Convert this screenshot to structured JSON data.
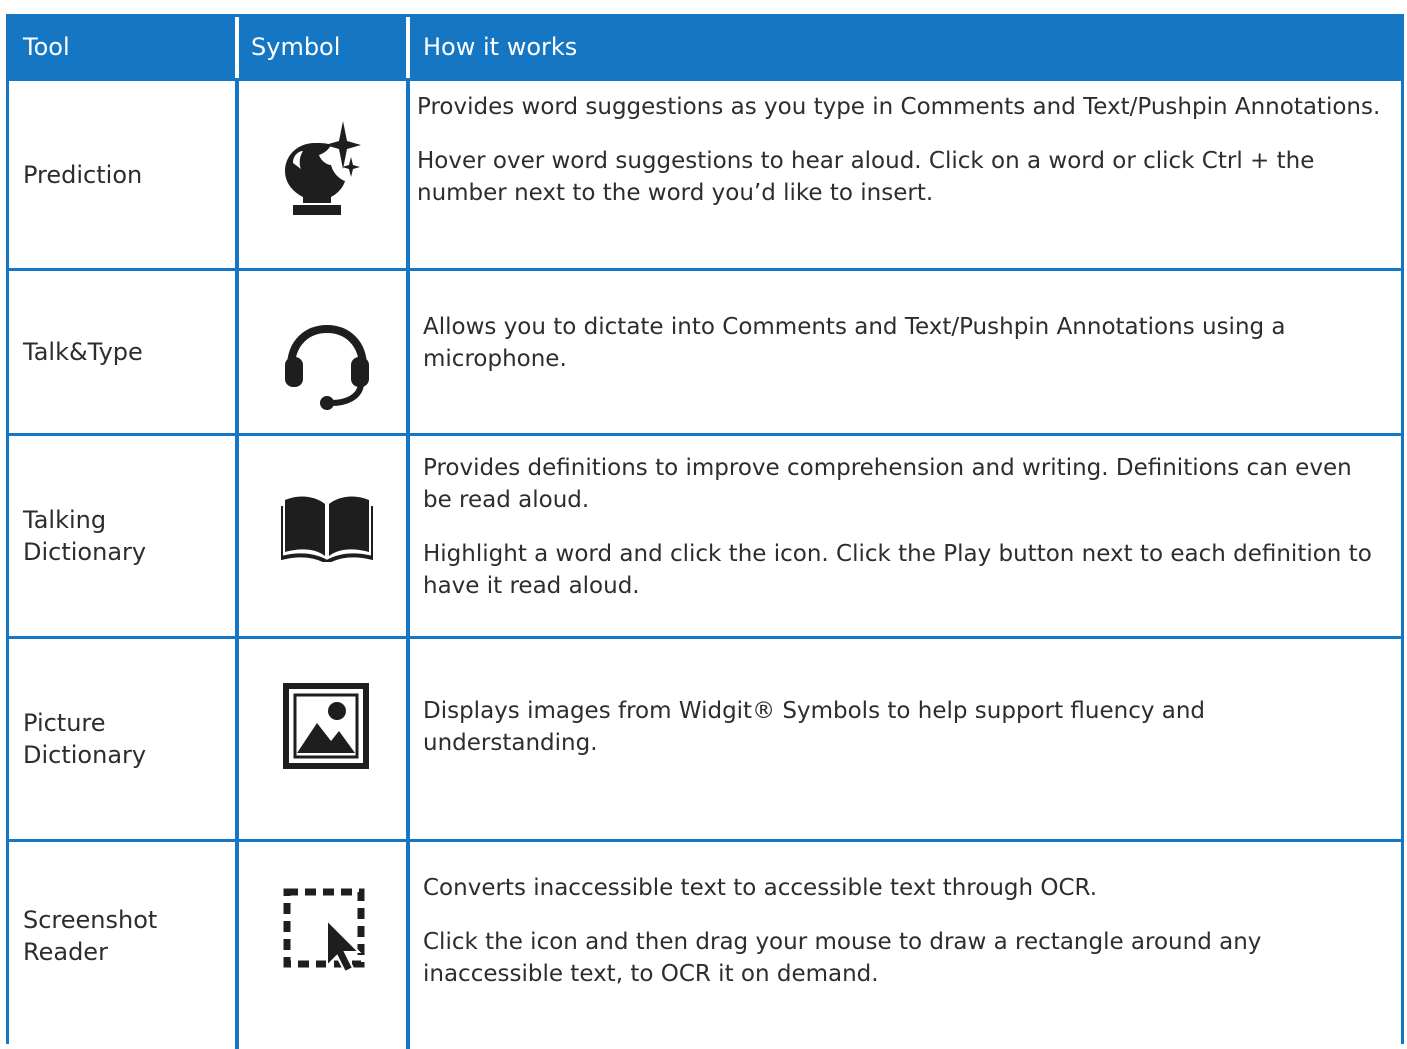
{
  "header": {
    "tool": "Tool",
    "symbol": "Symbol",
    "how": "How it works"
  },
  "rows": [
    {
      "tool_lines": [
        "Prediction"
      ],
      "icon": "prediction-crystal-ball-icon",
      "paragraphs": [
        "Provides word suggestions as you type in Comments and Text/Pushpin Annotations.",
        "Hover over word suggestions to hear aloud. Click on a word or click Ctrl + the number next to the word you’d like to insert."
      ]
    },
    {
      "tool_lines": [
        "Talk&Type"
      ],
      "icon": "headset-icon",
      "paragraphs": [
        "Allows you to dictate into Comments and Text/Pushpin Annotations using a microphone."
      ]
    },
    {
      "tool_lines": [
        "Talking",
        "Dictionary"
      ],
      "icon": "open-book-icon",
      "paragraphs": [
        "Provides definitions to improve comprehension and writing. Definitions can even be read aloud.",
        "Highlight a word and click the icon. Click the Play button next to each definition to have it read aloud."
      ]
    },
    {
      "tool_lines": [
        "Picture",
        "Dictionary"
      ],
      "icon": "picture-icon",
      "paragraphs": [
        "Displays images from Widgit® Symbols to help support fluency and understanding."
      ]
    },
    {
      "tool_lines": [
        "Screenshot",
        "Reader"
      ],
      "icon": "screenshot-select-icon",
      "paragraphs": [
        "Converts inaccessible text to accessible text through OCR.",
        "Click the icon and then drag your mouse to draw a rectangle around any inaccessible text, to OCR it on demand."
      ]
    }
  ],
  "colors": {
    "accent": "#1577c4",
    "text": "#2d2d2d",
    "icon": "#1e1e1e"
  }
}
